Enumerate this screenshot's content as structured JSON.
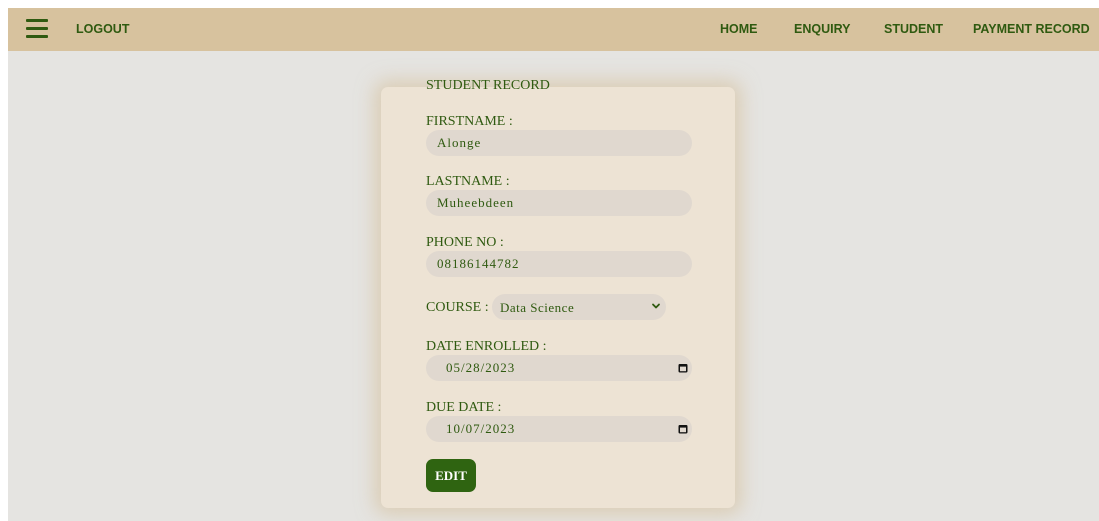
{
  "nav": {
    "logout": "LOGOUT",
    "links": [
      "HOME",
      "ENQUIRY",
      "STUDENT",
      "PAYMENT RECORD"
    ]
  },
  "form": {
    "legend": "STUDENT RECORD",
    "firstname_label": "FIRSTNAME :",
    "firstname_value": "Alonge",
    "lastname_label": "LASTNAME :",
    "lastname_value": "Muheebdeen",
    "phone_label": "PHONE NO :",
    "phone_value": "08186144782",
    "course_label": "COURSE :",
    "course_value": "Data Science",
    "date_enrolled_label": "DATE ENROLLED :",
    "date_enrolled_value": "05/28/2023",
    "due_date_label": "DUE DATE :",
    "due_date_value": "10/07/2023",
    "edit_label": "EDIT"
  },
  "icons": {
    "menu": "hamburger-menu-icon",
    "calendar": "calendar-icon",
    "dropdown": "chevron-down-icon"
  },
  "colors": {
    "navbar": "#d7c29e",
    "accent_green": "#2f5a10",
    "button": "#2f6411",
    "card": "#ede3d4",
    "input": "#e0d8cf",
    "background": "#e5e4e1"
  }
}
